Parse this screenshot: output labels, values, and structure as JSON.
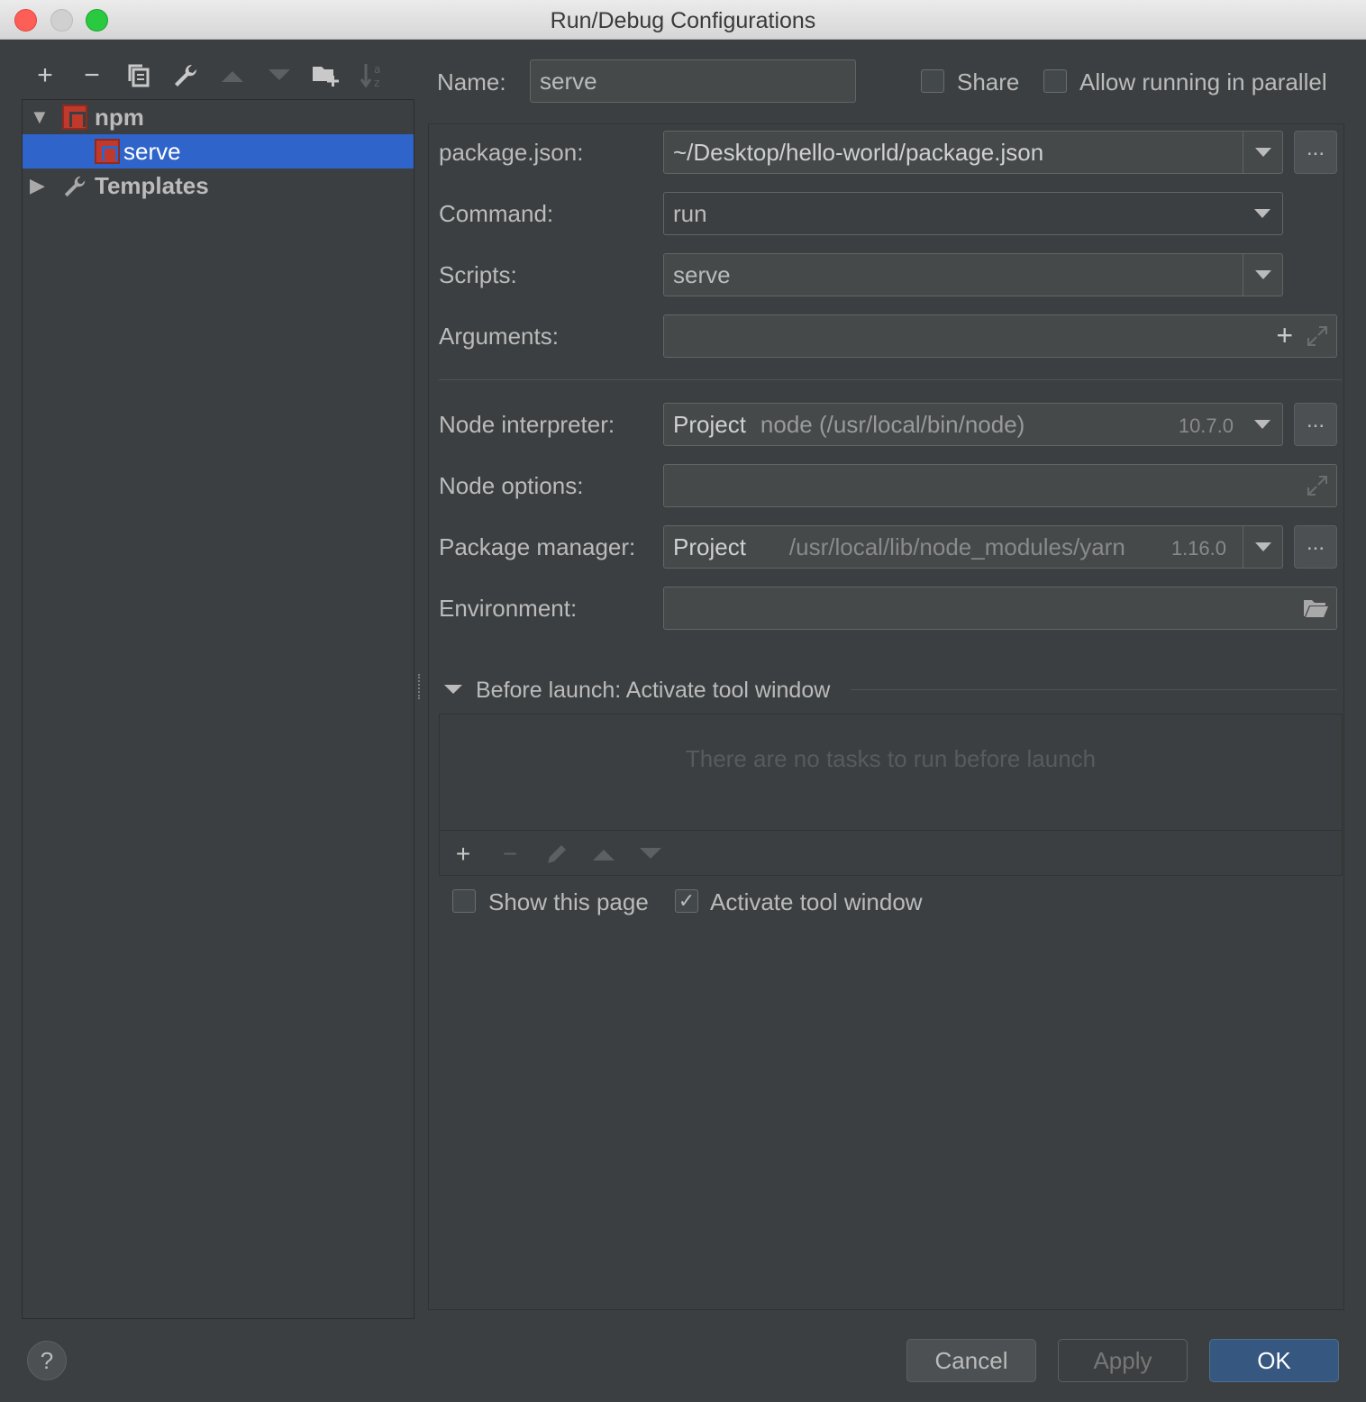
{
  "window": {
    "title": "Run/Debug Configurations"
  },
  "left_toolbar": {
    "icons": [
      "add-icon",
      "remove-icon",
      "copy-icon",
      "wrench-icon",
      "move-up-icon",
      "move-down-icon",
      "new-folder-icon",
      "sort-alpha-icon"
    ]
  },
  "tree": {
    "group_label": "npm",
    "selected_item": "serve",
    "templates_label": "Templates"
  },
  "header": {
    "name_label": "Name:",
    "name_value": "serve",
    "share_label": "Share",
    "share_checked": false,
    "parallel_label": "Allow running in parallel",
    "parallel_checked": false
  },
  "form": {
    "package_json_label": "package.json:",
    "package_json_value": "~/Desktop/hello-world/package.json",
    "command_label": "Command:",
    "command_value": "run",
    "scripts_label": "Scripts:",
    "scripts_value": "serve",
    "arguments_label": "Arguments:",
    "arguments_value": "",
    "node_interpreter_label": "Node interpreter:",
    "node_interpreter_scope": "Project",
    "node_interpreter_path": "node (/usr/local/bin/node)",
    "node_interpreter_version": "10.7.0",
    "node_options_label": "Node options:",
    "node_options_value": "",
    "package_manager_label": "Package manager:",
    "package_manager_scope": "Project",
    "package_manager_path": "/usr/local/lib/node_modules/yarn",
    "package_manager_version": "1.16.0",
    "environment_label": "Environment:",
    "environment_value": "",
    "dots_label": "..."
  },
  "before_launch": {
    "title": "Before launch: Activate tool window",
    "empty_text": "There are no tasks to run before launch",
    "show_page_label": "Show this page",
    "show_page_checked": false,
    "activate_label": "Activate tool window",
    "activate_checked": true
  },
  "footer": {
    "help_label": "?",
    "cancel_label": "Cancel",
    "apply_label": "Apply",
    "ok_label": "OK"
  },
  "colors": {
    "background": "#3c3f41",
    "selection": "#2f65ca",
    "npm_icon": "#c0392b",
    "ok_button": "#365880"
  }
}
